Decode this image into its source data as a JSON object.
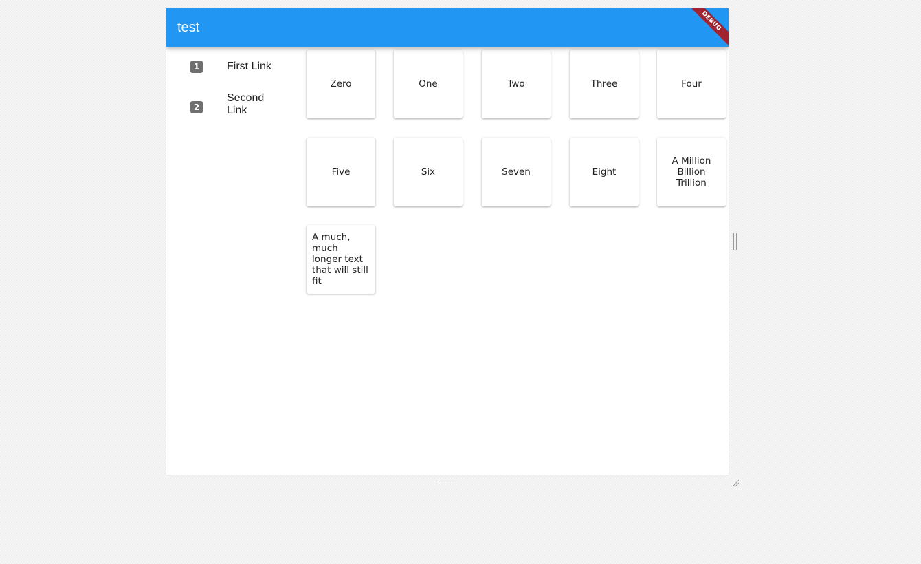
{
  "app_bar": {
    "title": "test",
    "color": "#2196f3"
  },
  "debug_banner": {
    "label": "DEBUG",
    "color": "#a0232f"
  },
  "nav_rail": {
    "items": [
      {
        "icon": "looks-one-icon",
        "glyph": "1",
        "label": "First Link"
      },
      {
        "icon": "looks-two-icon",
        "glyph": "2",
        "label": "Second Link"
      }
    ]
  },
  "grid": {
    "cards": [
      "Zero",
      "One",
      "Two",
      "Three",
      "Four",
      "Five",
      "Six",
      "Seven",
      "Eight",
      "A Million Billion Trillion",
      "A much, much longer text that will still fit"
    ]
  }
}
